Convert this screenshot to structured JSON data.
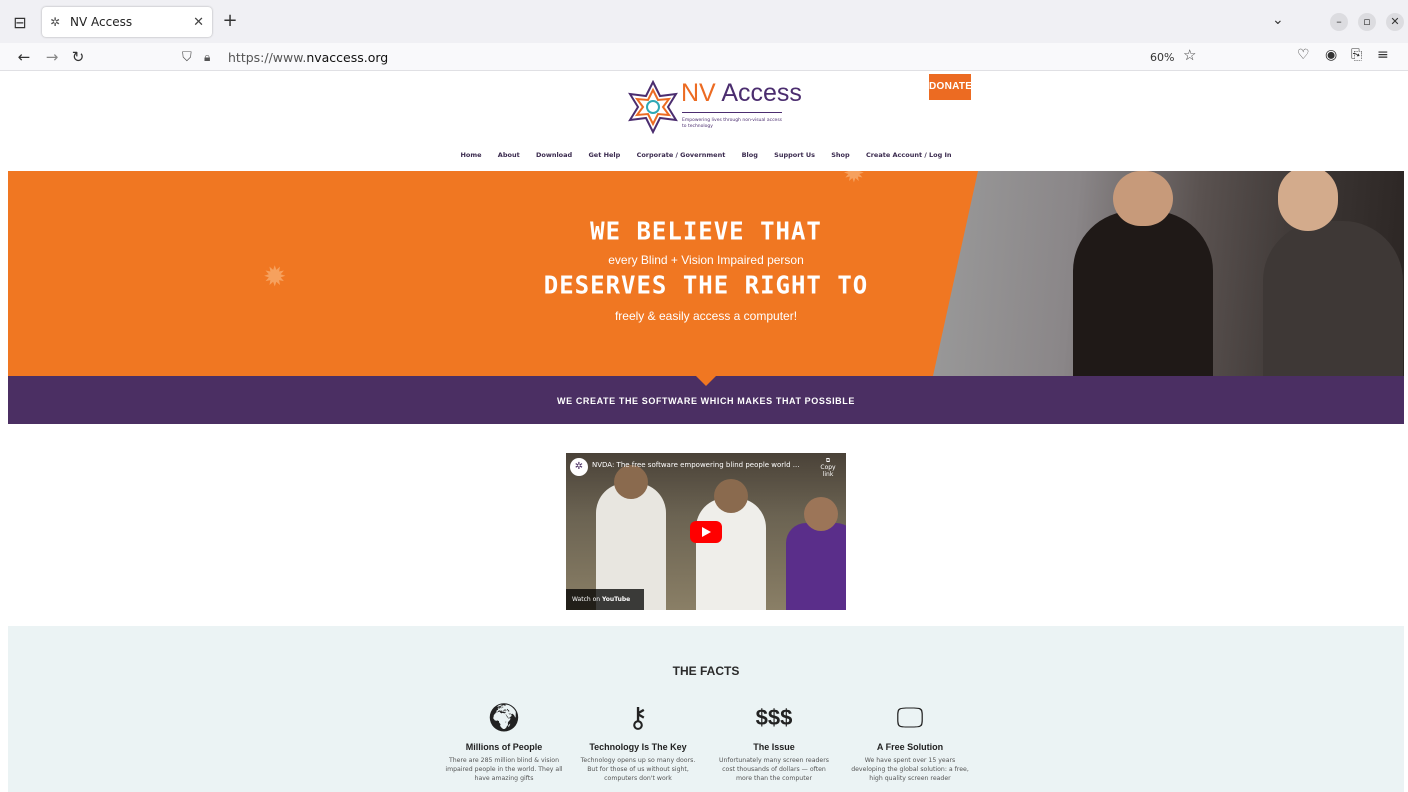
{
  "browser": {
    "tab_title": "NV Access",
    "url_prefix": "https://www.",
    "url_domain": "nvaccess.org",
    "zoom": "60%"
  },
  "site": {
    "logo_nv": "NV",
    "logo_access": "Access",
    "tagline": "Empowering lives through non-visual access to technology",
    "donate": "DONATE",
    "menu": [
      "Home",
      "About",
      "Download",
      "Get Help",
      "Corporate / Government",
      "Blog",
      "Support Us",
      "Shop",
      "Create Account / Log In"
    ]
  },
  "hero": {
    "line1": "WE BELIEVE THAT",
    "line2": "every Blind + Vision Impaired person",
    "line3": "DESERVES THE RIGHT TO",
    "line4": "freely & easily access a computer!"
  },
  "band": {
    "text": "WE CREATE THE SOFTWARE WHICH MAKES THAT POSSIBLE"
  },
  "video": {
    "title": "NVDA: The free software empowering blind people world ...",
    "copy_link": "Copy link",
    "watch_on": "Watch on",
    "youtube": "YouTube"
  },
  "facts": {
    "title": "THE FACTS",
    "items": [
      {
        "icon": "globe-icon",
        "title": "Millions of People",
        "desc": "There are 285 million blind & vision impaired people in the world. They all have amazing gifts"
      },
      {
        "icon": "key-icon",
        "title": "Technology Is The Key",
        "desc": "Technology opens up so many doors. But for those of us without sight, computers don't work"
      },
      {
        "icon": "dollar-icon",
        "title": "The Issue",
        "desc": "Unfortunately many screen readers cost thousands of dollars — often more than the computer"
      },
      {
        "icon": "monitor-check-icon",
        "title": "A Free Solution",
        "desc": "We have spent over 15 years developing the global solution: a free, high quality screen reader"
      }
    ],
    "dollar_glyph": "$$$"
  }
}
